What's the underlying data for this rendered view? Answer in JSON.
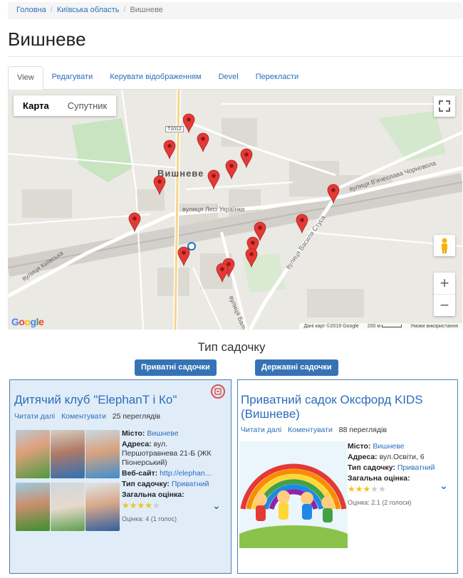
{
  "breadcrumb": {
    "home": "Головна",
    "region": "Київська область",
    "current": "Вишневе"
  },
  "page_title": "Вишневе",
  "tabs": [
    "View",
    "Редагувати",
    "Керувати відображенням",
    "Devel",
    "Перекласти"
  ],
  "map": {
    "type_map": "Карта",
    "type_satellite": "Супутник",
    "town": "Вишневе",
    "road_badge": "Т1012",
    "streets": {
      "lesi": "вулиця Лесі Українки",
      "kyivska": "вулиця Київська",
      "chornovola": "вулиця В'ячеслава Чорновола",
      "stusa": "вулиця Василя Стуса",
      "balukova": "вулиця Балукова"
    },
    "google": "Google",
    "attribution": "Дані карт ©2019 Google",
    "scale": "200 м",
    "terms": "Умови використання",
    "marker_color": "#e53935",
    "marker_count": 17
  },
  "section_title": "Тип садочку",
  "filters": {
    "private": "Приватні садочки",
    "public": "Державні садочки"
  },
  "cards": [
    {
      "title": "Дитячий клуб \"ElephanT і Ко\"",
      "read_more": "Читати далі",
      "comment": "Коментувати",
      "views": "25 переглядів",
      "labels": {
        "city": "Місто:",
        "address": "Адреса:",
        "website": "Веб-сайт:",
        "type": "Тип садочку:",
        "rating": "Загальна оцінка:"
      },
      "city": "Вишневе",
      "address_line1": "вул.",
      "address_line2": "Першотравнева 21-Б (ЖК Піонерський)",
      "website": "http://elephan...",
      "type": "Приватний",
      "rating_stars": 4,
      "rating_text": "Оцінка: 4 (1 голос)"
    },
    {
      "title": "Приватний садок Оксфорд KIDS (Вишневе)",
      "read_more": "Читати далі",
      "comment": "Коментувати",
      "views": "88 переглядів",
      "labels": {
        "city": "Місто:",
        "address": "Адреса:",
        "type": "Тип садочку:",
        "rating": "Загальна оцінка:"
      },
      "city": "Вишневе",
      "address": "вул.Освіти, 6",
      "type": "Приватний",
      "rating_stars": 2.1,
      "rating_text": "Оцінка: 2.1 (2 голоси)"
    }
  ]
}
